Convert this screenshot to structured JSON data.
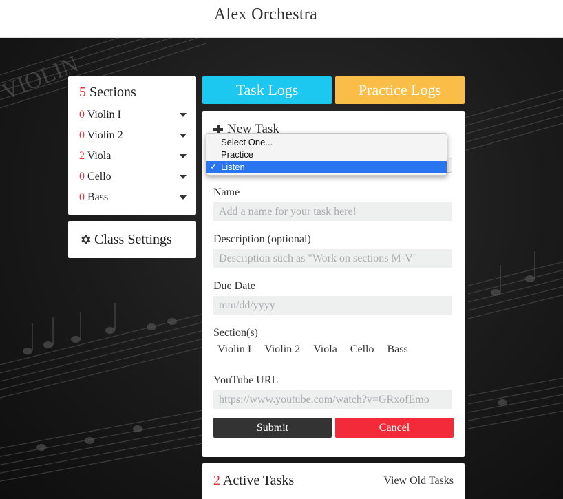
{
  "header": {
    "title": "Alex Orchestra"
  },
  "sections_panel": {
    "count": "5",
    "heading": "Sections",
    "items": [
      {
        "count": "0",
        "label": "Violin I"
      },
      {
        "count": "0",
        "label": "Violin 2"
      },
      {
        "count": "2",
        "label": "Viola"
      },
      {
        "count": "0",
        "label": "Cello"
      },
      {
        "count": "0",
        "label": "Bass"
      }
    ]
  },
  "class_settings": {
    "label": "Class Settings",
    "icon": "gear-icon"
  },
  "tabs": {
    "task_logs": "Task Logs",
    "practice_logs": "Practice Logs"
  },
  "form": {
    "title": "New Task",
    "task_type": {
      "options": [
        "Select One...",
        "Practice",
        "Listen"
      ],
      "selected": "Listen"
    },
    "name": {
      "label": "Name",
      "placeholder": "Add a name for your task here!"
    },
    "description": {
      "label": "Description (optional)",
      "placeholder": "Description such as \"Work on sections M-V\""
    },
    "due_date": {
      "label": "Due Date",
      "placeholder": "mm/dd/yyyy"
    },
    "sections": {
      "label": "Section(s)",
      "options": [
        "Violin I",
        "Violin 2",
        "Viola",
        "Cello",
        "Bass"
      ]
    },
    "youtube": {
      "label": "YouTube URL",
      "placeholder": "https://www.youtube.com/watch?v=GRxofEmo"
    },
    "submit_label": "Submit",
    "cancel_label": "Cancel"
  },
  "active_tasks": {
    "count": "2",
    "heading": "Active Tasks",
    "link": "View Old Tasks"
  },
  "colors": {
    "accent_red": "#e8323c",
    "task_logs_blue": "#1cc8ef",
    "practice_logs_yellow": "#f9bd48",
    "submit_dark": "#333333",
    "cancel_red": "#f22a3a",
    "selection_blue": "#2a76f0"
  }
}
